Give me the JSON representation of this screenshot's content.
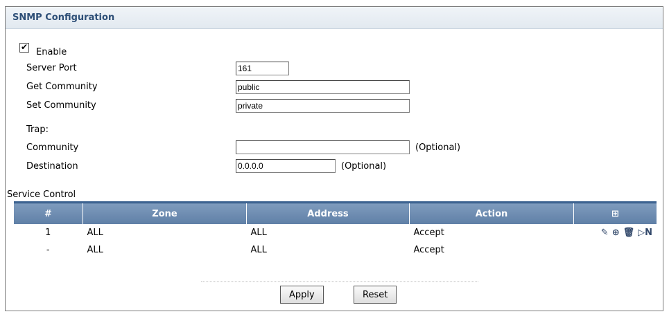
{
  "header": {
    "title": "SNMP Configuration"
  },
  "form": {
    "enable_checked": true,
    "enable_label": "Enable",
    "server_port_label": "Server Port",
    "server_port_value": "161",
    "get_community_label": "Get Community",
    "get_community_value": "public",
    "set_community_label": "Set Community",
    "set_community_value": "private",
    "trap_label": "Trap:",
    "trap_community_label": "Community",
    "trap_community_value": "",
    "trap_community_hint": "(Optional)",
    "trap_destination_label": "Destination",
    "trap_destination_value": "0.0.0.0",
    "trap_destination_hint": "(Optional)"
  },
  "service_control": {
    "title": "Service Control",
    "columns": [
      "#",
      "Zone",
      "Address",
      "Action"
    ],
    "add_icon": "add-rule-icon",
    "rows": [
      {
        "num": "1",
        "zone": "ALL",
        "address": "ALL",
        "action": "Accept",
        "icons": [
          "edit-icon",
          "insert-icon",
          "delete-icon",
          "move-icon"
        ]
      },
      {
        "num": "-",
        "zone": "ALL",
        "address": "ALL",
        "action": "Accept",
        "icons": []
      }
    ]
  },
  "buttons": {
    "apply": "Apply",
    "reset": "Reset"
  },
  "colors": {
    "header_text": "#2e4f77",
    "table_header": "#6f8db2"
  }
}
